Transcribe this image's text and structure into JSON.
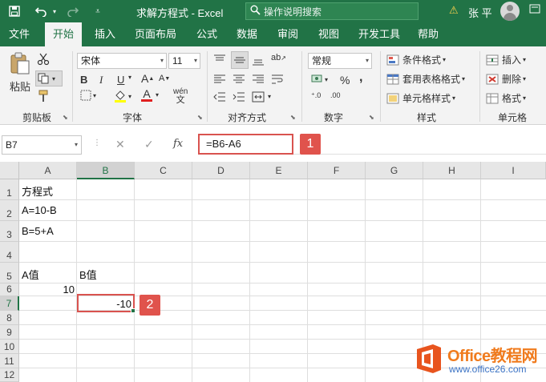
{
  "titlebar": {
    "title": "求解方程式  -  Excel",
    "search_placeholder": "操作说明搜索",
    "user_name": "张 平",
    "icons": [
      "save-icon",
      "undo-icon",
      "redo-icon",
      "customize-quick-access-icon",
      "search-icon",
      "warning-icon",
      "user-avatar-icon",
      "ribbon-display-icon"
    ]
  },
  "tabs": [
    "文件",
    "开始",
    "插入",
    "页面布局",
    "公式",
    "数据",
    "审阅",
    "视图",
    "开发工具",
    "帮助"
  ],
  "active_tab": "开始",
  "ribbon": {
    "clipboard": {
      "paste_label": "粘贴",
      "group_label": "剪贴板"
    },
    "font": {
      "font_name": "宋体",
      "font_size": "11",
      "bold": "B",
      "italic": "I",
      "underline": "U",
      "font_color_glyph": "A",
      "phonetic": "wén",
      "group_label": "字体"
    },
    "alignment": {
      "group_label": "对齐方式"
    },
    "number": {
      "format": "常规",
      "percent": "%",
      "comma": ",",
      "group_label": "数字"
    },
    "styles": {
      "conditional": "条件格式",
      "table": "套用表格格式",
      "cell_styles": "单元格样式",
      "group_label": "样式"
    },
    "cells": {
      "insert": "插入",
      "delete": "删除",
      "format": "格式",
      "group_label": "单元格"
    }
  },
  "formula_bar": {
    "name_box": "B7",
    "cancel": "✕",
    "enter": "✓",
    "fx": "fx",
    "formula": "=B6-A6",
    "callout": "1"
  },
  "sheet": {
    "columns": [
      "A",
      "B",
      "C",
      "D",
      "E",
      "F",
      "G",
      "H",
      "I"
    ],
    "selected_column": "B",
    "rows": [
      "1",
      "2",
      "3",
      "4",
      "5",
      "6",
      "7",
      "8",
      "9",
      "10",
      "11",
      "12"
    ],
    "selected_row": "7",
    "cells": {
      "A1": "方程式",
      "A2": "A=10-B",
      "A3": "B=5+A",
      "A5": "A值",
      "B5": "B值",
      "A6": "10",
      "B7": "-10"
    },
    "active_cell": "B7",
    "callout": "2"
  },
  "watermark": {
    "name": "Office教程网",
    "url": "www.office26.com"
  },
  "colors": {
    "excel_green": "#217346",
    "callout_red": "#e0534c",
    "watermark_orange": "#f07b1d"
  }
}
